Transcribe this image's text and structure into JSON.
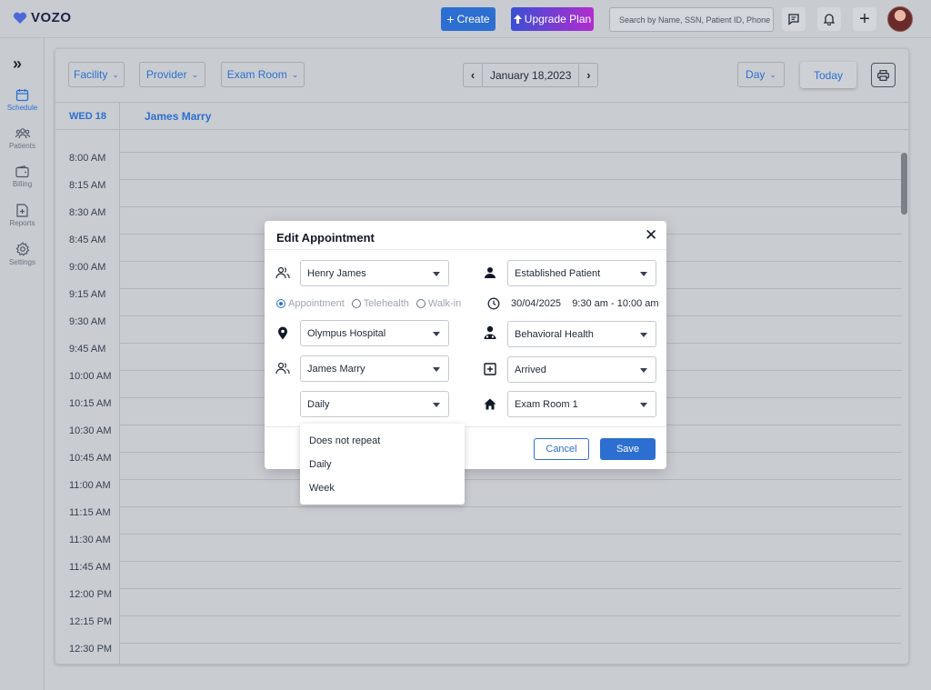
{
  "app": {
    "logo_text": "VOZO"
  },
  "header": {
    "create_label": "Create",
    "upgrade_label": "Upgrade Plan",
    "search_placeholder": "Search by Name, SSN, Patient ID, Phone"
  },
  "sidebar": {
    "items": [
      {
        "label": "Schedule",
        "icon": "calendar-icon",
        "active": true
      },
      {
        "label": "Patients",
        "icon": "users-icon",
        "active": false
      },
      {
        "label": "Billing",
        "icon": "wallet-icon",
        "active": false
      },
      {
        "label": "Reports",
        "icon": "report-icon",
        "active": false
      },
      {
        "label": "Settings",
        "icon": "gear-icon",
        "active": false
      }
    ]
  },
  "toolbar": {
    "facility_label": "Facility",
    "provider_label": "Provider",
    "exam_room_label": "Exam Room",
    "date": "January 18,2023",
    "view_label": "Day",
    "today_label": "Today"
  },
  "calendar": {
    "day_header": "WED 18",
    "provider_header": "James Marry",
    "times": [
      "8:00 AM",
      "8:15 AM",
      "8:30 AM",
      "8:45 AM",
      "9:00 AM",
      "9:15 AM",
      "9:30 AM",
      "9:45 AM",
      "10:00 AM",
      "10:15 AM",
      "10:30 AM",
      "10:45 AM",
      "11:00 AM",
      "11:15 AM",
      "11:30 AM",
      "11:45 AM",
      "12:00 PM",
      "12:15 PM",
      "12:30 PM"
    ]
  },
  "modal": {
    "title": "Edit Appointment",
    "patient": "Henry James",
    "patient_type": "Established Patient",
    "appointment_types": [
      "Appointment",
      "Telehealth",
      "Walk-in"
    ],
    "selected_type": "Appointment",
    "date": "30/04/2025",
    "time_range": "9:30 am - 10:00 am",
    "facility": "Olympus Hospital",
    "department": "Behavioral Health",
    "provider": "James Marry",
    "status": "Arrived",
    "repeat": "Daily",
    "exam_room": "Exam Room 1",
    "cancel_label": "Cancel",
    "save_label": "Save"
  },
  "repeat_menu": {
    "options": [
      "Does not repeat",
      "Daily",
      "Week"
    ]
  },
  "colors": {
    "accent": "#2d6fd1",
    "upgrade_gradient_start": "#3a4fd4",
    "upgrade_gradient_end": "#b12ccf"
  }
}
